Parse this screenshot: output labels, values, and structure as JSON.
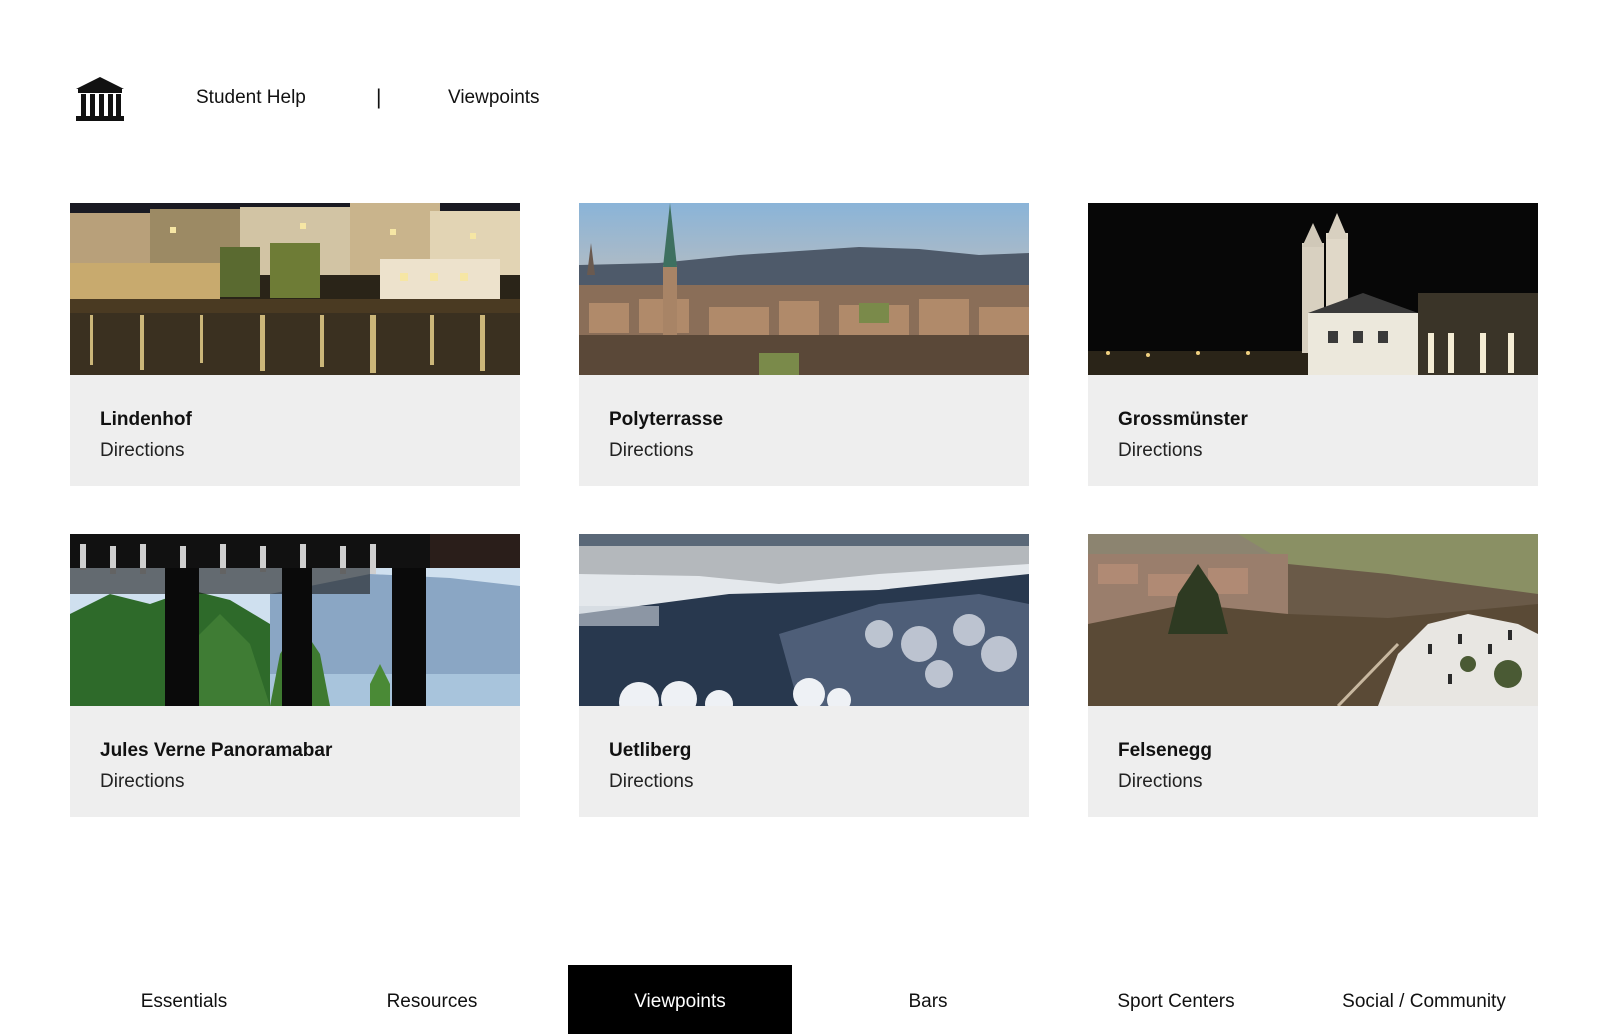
{
  "header": {
    "logo_icon": "museum-columns-icon",
    "student_help_label": "Student Help",
    "separator": "|",
    "current_section_label": "Viewpoints"
  },
  "cards": [
    {
      "title": "Lindenhof",
      "link_label": "Directions",
      "image": "riverside-buildings-night-photo"
    },
    {
      "title": "Polyterrasse",
      "link_label": "Directions",
      "image": "city-skyline-sunset-photo"
    },
    {
      "title": "Grossmünster",
      "link_label": "Directions",
      "image": "cathedral-towers-night-photo"
    },
    {
      "title": "Jules Verne Panoramabar",
      "link_label": "Directions",
      "image": "bar-window-lake-view-photo"
    },
    {
      "title": "Uetliberg",
      "link_label": "Directions",
      "image": "snowy-forest-valley-photo"
    },
    {
      "title": "Felsenegg",
      "link_label": "Directions",
      "image": "hilltop-viewpoint-winter-photo"
    }
  ],
  "bottom_nav": {
    "items": [
      {
        "label": "Essentials",
        "active": false
      },
      {
        "label": "Resources",
        "active": false
      },
      {
        "label": "Viewpoints",
        "active": true
      },
      {
        "label": "Bars",
        "active": false
      },
      {
        "label": "Sport Centers",
        "active": false
      },
      {
        "label": "Social / Community",
        "active": false
      }
    ]
  },
  "colors": {
    "card_background": "#eeeeee",
    "active_nav_background": "#000000",
    "active_nav_text": "#ffffff",
    "text": "#111111"
  }
}
